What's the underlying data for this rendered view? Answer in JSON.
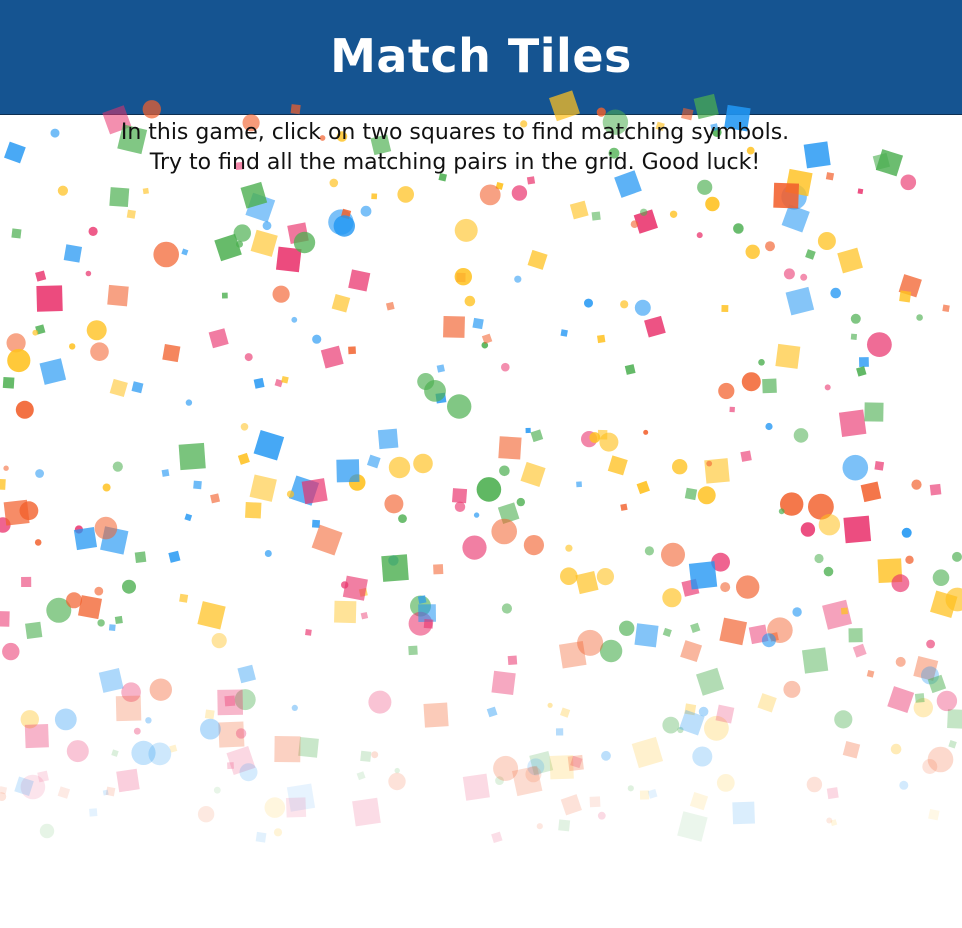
{
  "header": {
    "title": "Match Tiles"
  },
  "instructions": {
    "line1": "In this game, click on two squares to find matching symbols.",
    "line2": "Try to find all the matching pairs in the grid. Good luck!"
  },
  "colors": {
    "header_bg": "#155491",
    "confetti": [
      "#e9306b",
      "#f2602c",
      "#ffc11f",
      "#4caf50",
      "#2196f3"
    ]
  }
}
